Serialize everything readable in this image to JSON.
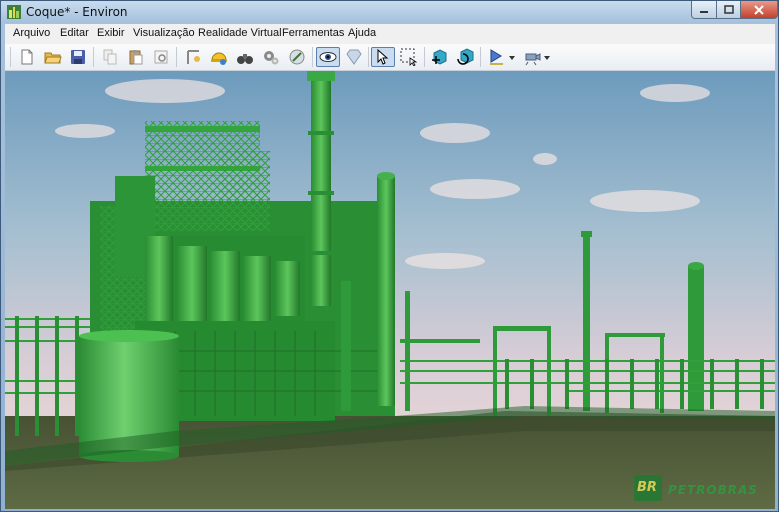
{
  "window": {
    "title": "Coque* - Environ"
  },
  "menu": [
    {
      "label": "Arquivo"
    },
    {
      "label": "Editar"
    },
    {
      "label": "Exibir"
    },
    {
      "label": "Visualização"
    },
    {
      "label": "Realidade Virtual"
    },
    {
      "label": "Ferramentas"
    },
    {
      "label": "Ajuda"
    }
  ],
  "toolbar": {
    "pressed": [
      "eye-view-icon",
      "select-arrow-icon"
    ]
  },
  "scene": {
    "watermark_logo": "BR",
    "watermark_text": "PETROBRAS",
    "colors": {
      "structure": "#2e9a3a",
      "structure_dark": "#1d6e26",
      "sky_top": "#6c9bbd",
      "sky_bottom": "#dfcfd6",
      "ground": "#4f5e3a"
    }
  }
}
